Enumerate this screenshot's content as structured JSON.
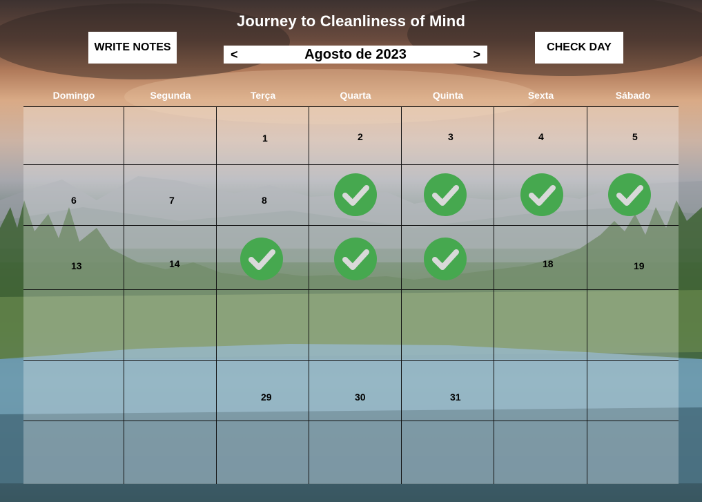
{
  "header": {
    "title": "Journey to Cleanliness of Mind",
    "write_notes_label": "WRITE NOTES",
    "check_day_label": "CHECK DAY",
    "month_label": "Agosto de 2023",
    "prev_arrow": "<",
    "next_arrow": ">"
  },
  "weekdays": [
    "Domingo",
    "Segunda",
    "Terça",
    "Quarta",
    "Quinta",
    "Sexta",
    "Sábado"
  ],
  "calendar": {
    "rows": [
      [
        "",
        "",
        "1",
        "2",
        "3",
        "4",
        "5"
      ],
      [
        "6",
        "7",
        "8",
        "",
        "",
        "",
        ""
      ],
      [
        "13",
        "14",
        "",
        "",
        "",
        "18",
        "19"
      ],
      [
        "",
        "",
        "",
        "",
        "",
        "",
        ""
      ],
      [
        "",
        "",
        "29",
        "30",
        "31",
        "",
        ""
      ],
      [
        "",
        "",
        "",
        "",
        "",
        "",
        ""
      ]
    ],
    "checked_days": [
      "9",
      "10",
      "11",
      "12",
      "15",
      "16",
      "17"
    ]
  },
  "colors": {
    "check": "#46a84f",
    "checkmark": "#d9d9d9"
  },
  "icons": {
    "check": "check-circle-icon",
    "prev": "chevron-left-icon",
    "next": "chevron-right-icon"
  }
}
